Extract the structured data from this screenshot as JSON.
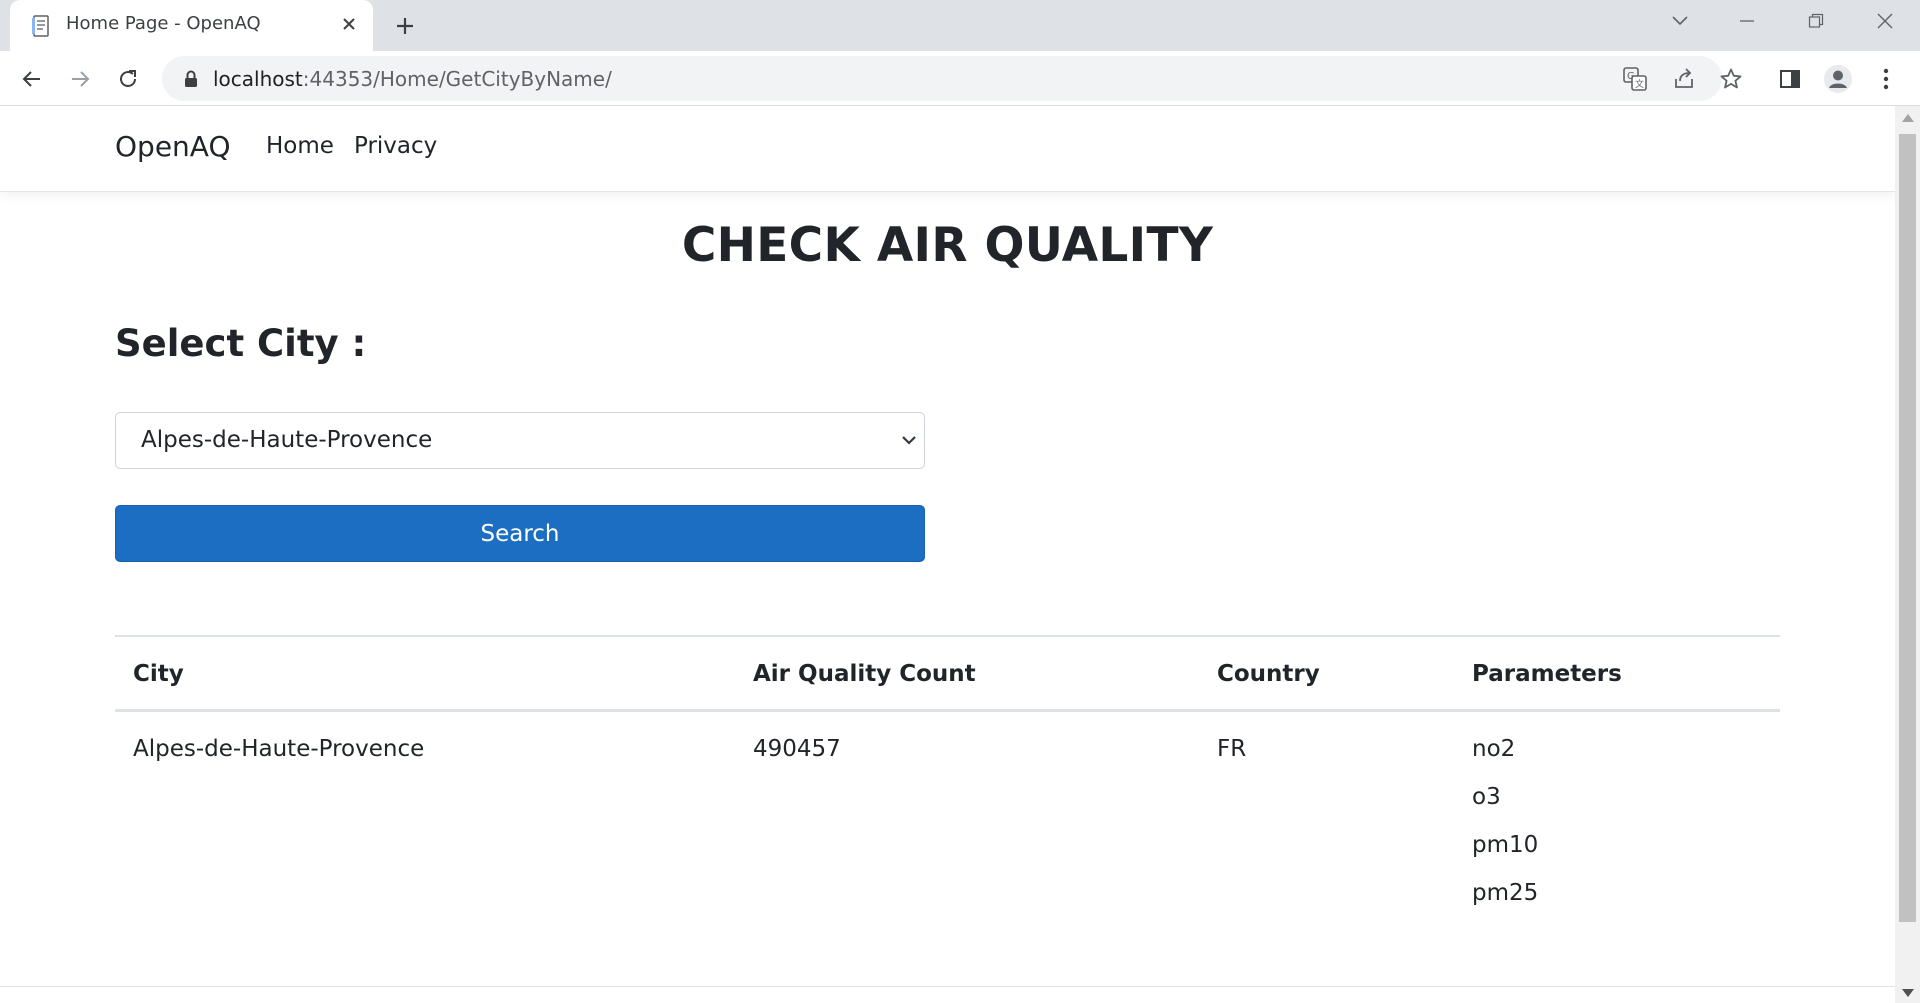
{
  "browser": {
    "tab_title": "Home Page - OpenAQ",
    "url_host": "localhost",
    "url_rest": ":44353/Home/GetCityByName/"
  },
  "navbar": {
    "brand": "OpenAQ",
    "links": [
      "Home",
      "Privacy"
    ]
  },
  "main": {
    "title": "CHECK AIR QUALITY",
    "select_label": "Select City :",
    "selected_city": "Alpes-de-Haute-Provence",
    "search_label": "Search"
  },
  "table": {
    "headers": [
      "City",
      "Air Quality Count",
      "Country",
      "Parameters"
    ],
    "rows": [
      {
        "city": "Alpes-de-Haute-Provence",
        "count": "490457",
        "country": "FR",
        "parameters": [
          "no2",
          "o3",
          "pm10",
          "pm25"
        ]
      }
    ]
  },
  "colors": {
    "primary_button": "#1b6ec2",
    "text": "#212529",
    "tabstrip": "#dee1e6"
  }
}
